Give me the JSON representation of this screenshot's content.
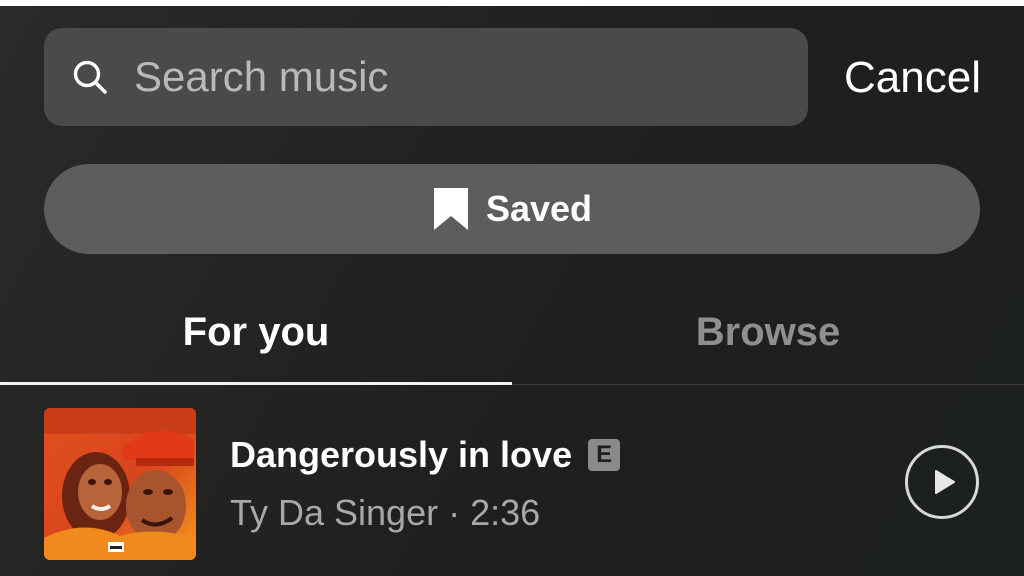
{
  "search": {
    "placeholder": "Search music",
    "value": "",
    "icon": "search-icon"
  },
  "cancel_label": "Cancel",
  "saved_button": {
    "label": "Saved",
    "icon": "bookmark-icon"
  },
  "tabs": [
    {
      "label": "For you",
      "active": true
    },
    {
      "label": "Browse",
      "active": false
    }
  ],
  "tracks": [
    {
      "title": "Dangerously in love",
      "explicit_badge": "E",
      "artist": "Ty Da Singer",
      "separator": " · ",
      "duration": "2:36",
      "art_palette": [
        "#d9451c",
        "#f08a1c",
        "#7a2a14"
      ],
      "action_icon": "play-circle-icon"
    }
  ],
  "colors": {
    "background": "#1f1f1e",
    "search_fill": "#4a4a48",
    "saved_fill": "#5d5d5b",
    "tab_inactive": "#8f8f8d",
    "secondary_text": "#a8a8a6"
  }
}
